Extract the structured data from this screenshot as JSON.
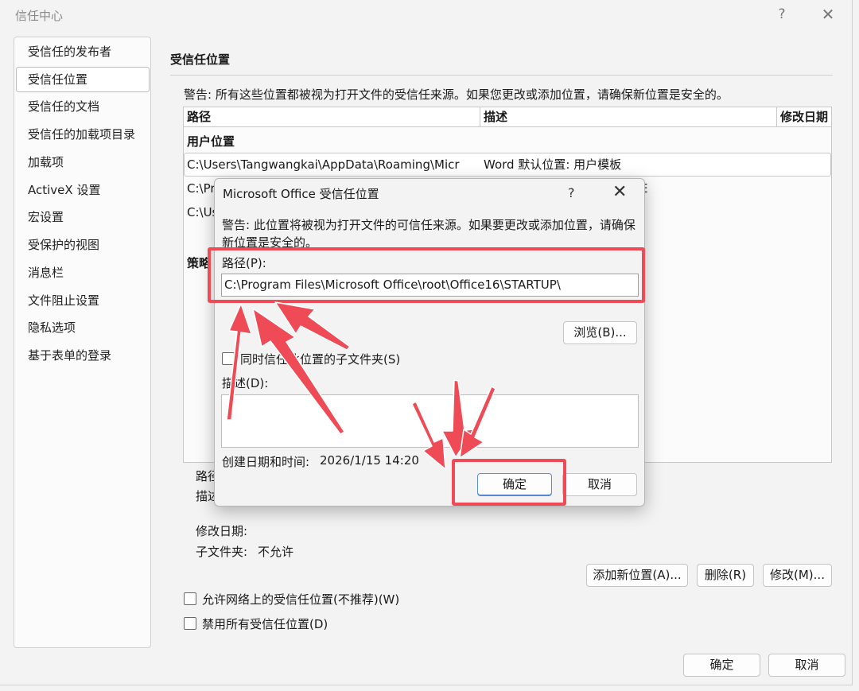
{
  "window": {
    "title": "信任中心",
    "help_glyph": "?",
    "close_glyph": "✕"
  },
  "sidebar": {
    "items": [
      {
        "label": "受信任的发布者"
      },
      {
        "label": "受信任位置"
      },
      {
        "label": "受信任的文档"
      },
      {
        "label": "受信任的加载项目录"
      },
      {
        "label": "加载项"
      },
      {
        "label": "ActiveX 设置"
      },
      {
        "label": "宏设置"
      },
      {
        "label": "受保护的视图"
      },
      {
        "label": "消息栏"
      },
      {
        "label": "文件阻止设置"
      },
      {
        "label": "隐私选项"
      },
      {
        "label": "基于表单的登录"
      }
    ],
    "selected_index": 1
  },
  "main": {
    "heading": "受信任位置",
    "warning": "警告: 所有这些位置都被视为打开文件的受信任来源。如果您更改或添加位置，请确保新位置是安全的。",
    "table": {
      "columns": [
        "路径",
        "描述",
        "修改日期"
      ],
      "group_user": "用户位置",
      "rows": [
        {
          "path": "C:\\Users\\Tangwangkai\\AppData\\Roaming\\Micr",
          "desc": "Word 默认位置: 用户模板"
        },
        {
          "path": "C:\\Pr",
          "desc": ""
        },
        {
          "path": "C:\\Us",
          "desc": ""
        }
      ],
      "policy_label": "策略",
      "row2_tail": "E"
    },
    "details": {
      "path_label": "路径",
      "desc_label": "描述",
      "modified_label": "修改日期:",
      "subfolder_label": "子文件夹:",
      "subfolder_value": "不允许"
    },
    "buttons": {
      "add": "添加新位置(A)...",
      "remove": "删除(R)",
      "modify": "修改(M)..."
    },
    "checkboxes": {
      "allow_network": "允许网络上的受信任位置(不推荐)(W)",
      "disable_all": "禁用所有受信任位置(D)"
    }
  },
  "footer": {
    "ok": "确定",
    "cancel": "取消"
  },
  "dialog": {
    "title": "Microsoft Office 受信任位置",
    "help_glyph": "?",
    "close_glyph": "✕",
    "warning": "警告: 此位置将被视为打开文件的可信任来源。如果要更改或添加位置，请确保新位置是安全的。",
    "path_label": "路径(P):",
    "path_value": "C:\\Program Files\\Microsoft Office\\root\\Office16\\STARTUP\\",
    "browse": "浏览(B)...",
    "subfolders_label": "同时信任此位置的子文件夹(S)",
    "desc_label": "描述(D):",
    "desc_value": "",
    "created_label": "创建日期和时间:",
    "created_value": "2026/1/15 14:20",
    "ok": "确定",
    "cancel": "取消"
  },
  "annotation_color": "#ef4b56"
}
